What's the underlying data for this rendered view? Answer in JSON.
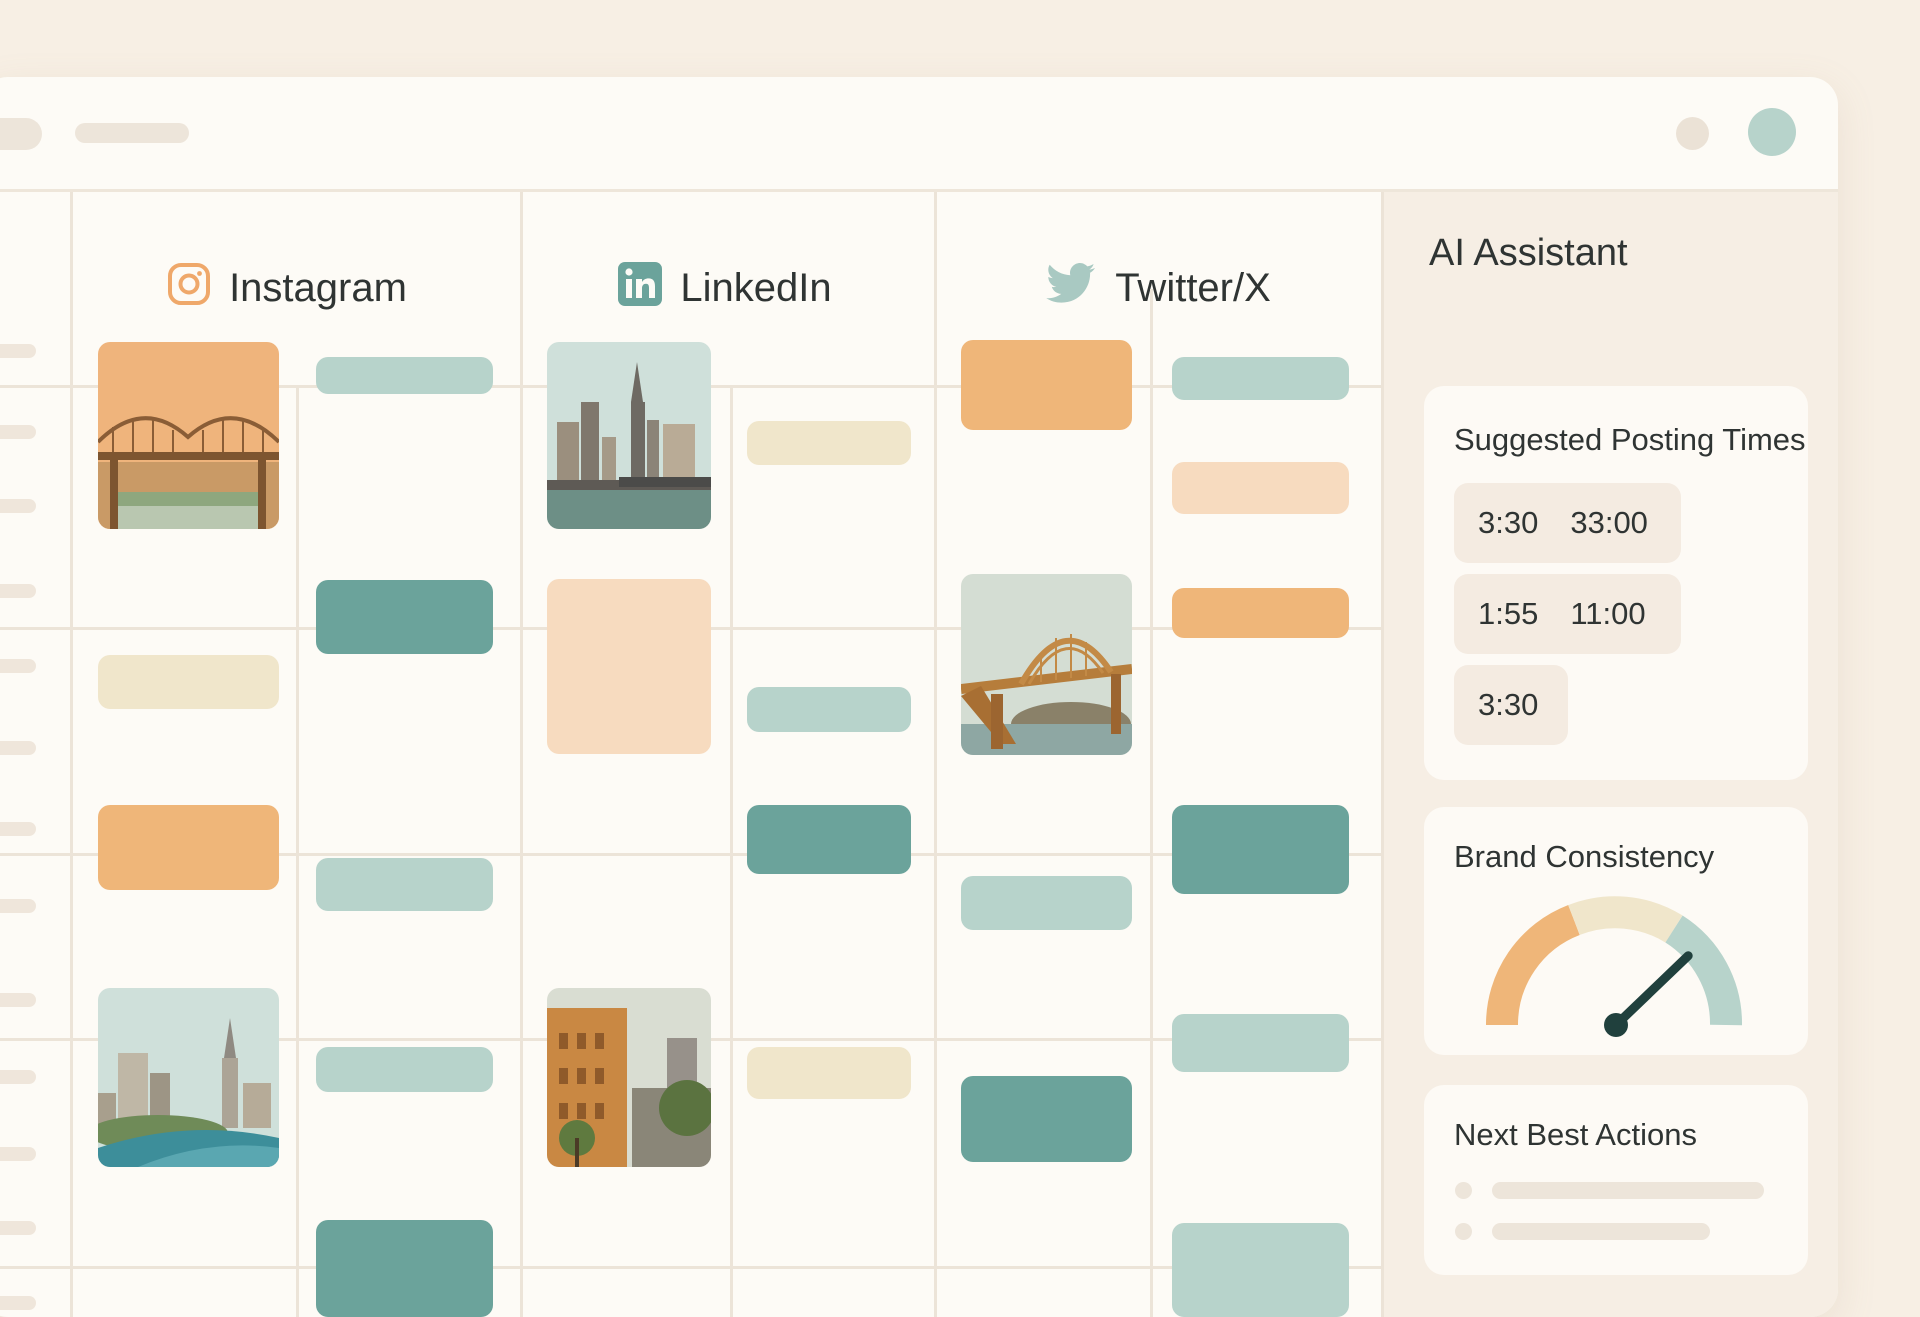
{
  "columns": [
    {
      "platform": "Instagram",
      "icon": "instagram-icon"
    },
    {
      "platform": "LinkedIn",
      "icon": "linkedin-icon"
    },
    {
      "platform": "Twitter/X",
      "icon": "twitter-icon"
    }
  ],
  "assistant": {
    "title": "AI Assistant",
    "suggested_times": {
      "title": "Suggested Posting Times",
      "slots": [
        {
          "a": "3:30",
          "b": "33:00"
        },
        {
          "a": "1:55",
          "b": "11:00"
        },
        {
          "a": "3:30",
          "b": ""
        }
      ]
    },
    "brand_consistency": {
      "title": "Brand Consistency",
      "gauge_level": 0.78
    },
    "next_best_actions": {
      "title": "Next Best Actions"
    }
  },
  "colors": {
    "orange": "#efb679",
    "teal": "#6ba39b",
    "sage": "#b7d3cb",
    "cream": "#f0e6cb",
    "peach": "#f7dbbf",
    "background": "#f7efe4"
  }
}
